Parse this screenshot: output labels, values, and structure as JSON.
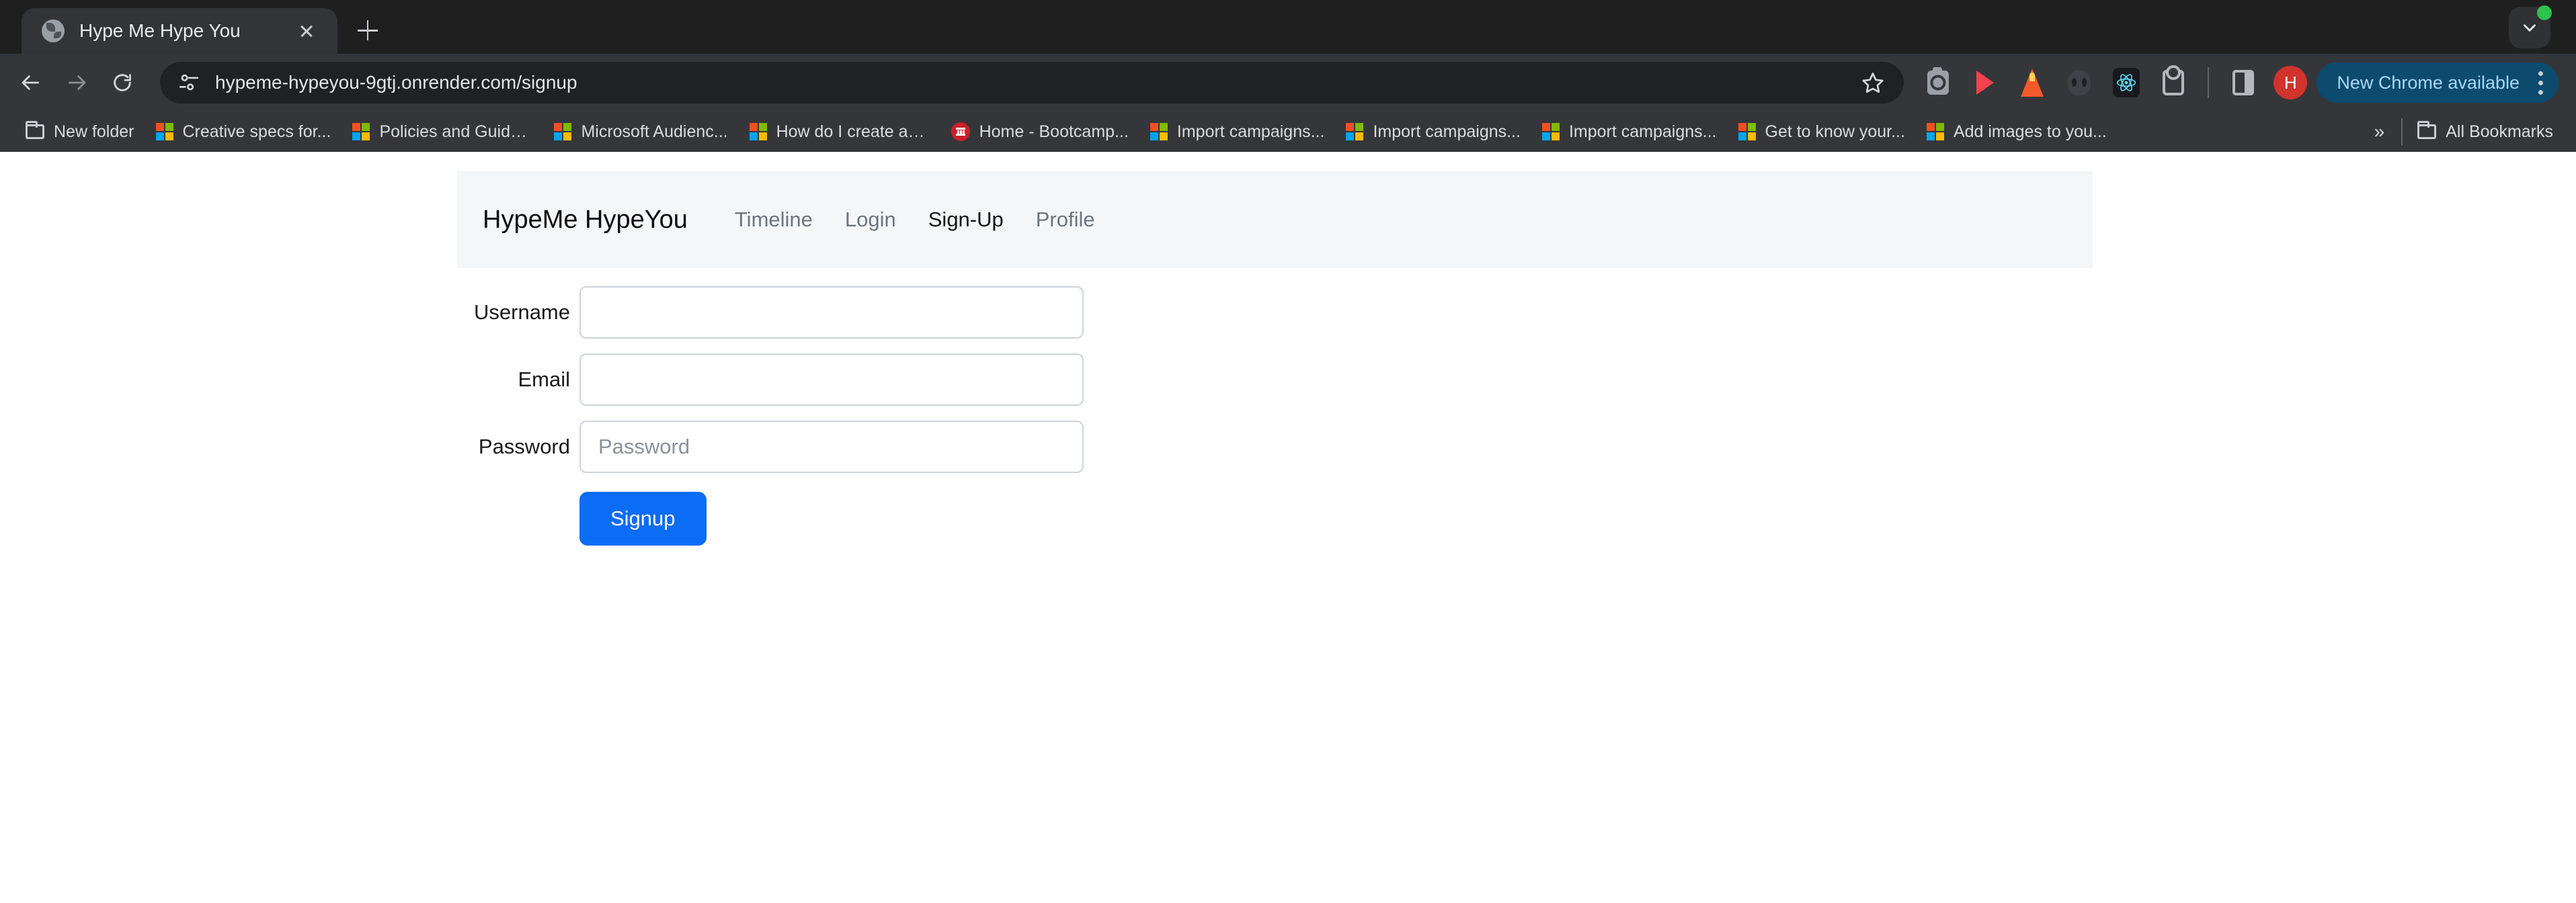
{
  "browser": {
    "tab": {
      "title": "Hype Me Hype You",
      "favicon": "globe-icon",
      "close": "×"
    },
    "new_tab_label": "+",
    "tab_search": "chevron-down-icon",
    "omnibox": {
      "url": "hypeme-hypeyou-9gtj.onrender.com/signup",
      "site_info_icon": "tune-icon",
      "bookmark_icon": "star-icon"
    },
    "nav": {
      "back": "back-arrow-icon",
      "forward": "forward-arrow-icon",
      "reload": "reload-icon"
    },
    "extensions": [
      {
        "name": "screenshot-camera-extension"
      },
      {
        "name": "red-arrow-extension"
      },
      {
        "name": "lighthouse-extension"
      },
      {
        "name": "mask-extension"
      },
      {
        "name": "react-devtools-extension"
      },
      {
        "name": "extensions-puzzle-icon"
      }
    ],
    "side_panel_icon": "side-panel-icon",
    "profile": {
      "initial": "H",
      "color": "#d0342c"
    },
    "update": {
      "label": "New Chrome available",
      "bg": "#0c4a6e",
      "text_color": "#a8d8f8"
    },
    "menu": "three-dot-menu-icon",
    "bookmarks": [
      {
        "label": "New folder",
        "icon": "folder-icon"
      },
      {
        "label": "Creative specs for...",
        "icon": "microsoft-icon"
      },
      {
        "label": "Policies and Guide...",
        "icon": "microsoft-icon"
      },
      {
        "label": "Microsoft Audienc...",
        "icon": "microsoft-icon"
      },
      {
        "label": "How do I create an...",
        "icon": "microsoft-icon"
      },
      {
        "label": "Home - Bootcamp...",
        "icon": "bootcamp-icon"
      },
      {
        "label": "Import campaigns...",
        "icon": "microsoft-icon"
      },
      {
        "label": "Import campaigns...",
        "icon": "microsoft-icon"
      },
      {
        "label": "Import campaigns...",
        "icon": "microsoft-icon"
      },
      {
        "label": "Get to know your...",
        "icon": "microsoft-icon"
      },
      {
        "label": "Add images to you...",
        "icon": "microsoft-icon"
      }
    ],
    "bookmarks_overflow": "»",
    "all_bookmarks": {
      "label": "All Bookmarks",
      "icon": "folder-icon"
    }
  },
  "site": {
    "brand": "HypeMe HypeYou",
    "nav_links": [
      {
        "label": "Timeline",
        "active": false
      },
      {
        "label": "Login",
        "active": false
      },
      {
        "label": "Sign-Up",
        "active": true
      },
      {
        "label": "Profile",
        "active": false
      }
    ],
    "form": {
      "fields": [
        {
          "label": "Username",
          "value": "",
          "placeholder": "",
          "type": "text"
        },
        {
          "label": "Email",
          "value": "",
          "placeholder": "",
          "type": "text"
        },
        {
          "label": "Password",
          "value": "",
          "placeholder": "Password",
          "type": "password"
        }
      ],
      "submit_label": "Signup",
      "submit_color": "#0b6cf5"
    }
  }
}
